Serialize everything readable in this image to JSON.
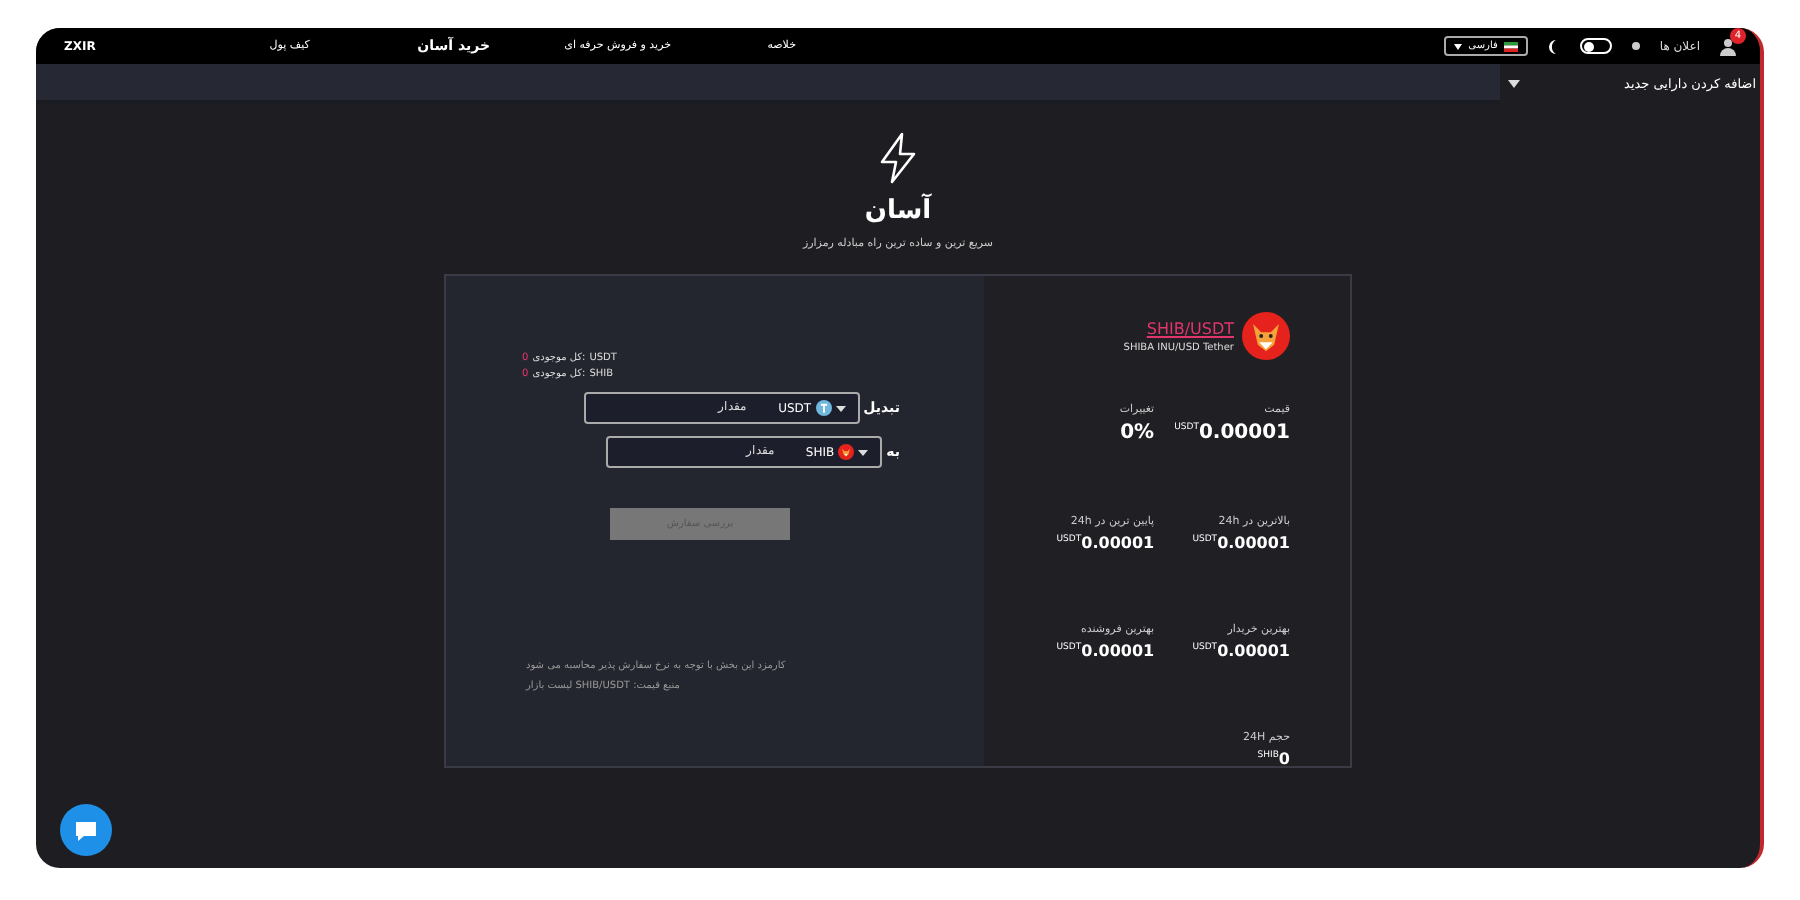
{
  "nav": {
    "logo": "ZXIR",
    "items": [
      {
        "label": "خلاصه",
        "selected": false
      },
      {
        "label": "خرید و فروش حرفه ای",
        "selected": false
      },
      {
        "label": "خرید آسان",
        "selected": true
      },
      {
        "label": "کیف پول",
        "selected": false
      }
    ],
    "language": "فارسی",
    "theme_toggle": {
      "on": false
    },
    "notifications": {
      "label": "اعلان ها",
      "badge": "4"
    }
  },
  "sub_bar": {
    "label": "اضافه کردن دارایی جدید"
  },
  "hero": {
    "title": "آسان",
    "subtitle": "سریع ترین و ساده ترین راه مبادله رمزارز"
  },
  "form": {
    "balances": [
      {
        "label": "کل موجودی:",
        "currency": "USDT",
        "value": "0"
      },
      {
        "label": "کل موجودی:",
        "currency": "SHIB",
        "value": "0"
      }
    ],
    "fields": [
      {
        "label": "تبدیل",
        "currency": "USDT",
        "kind": "tether",
        "placeholder": "مقدار"
      },
      {
        "label": "به",
        "currency": "SHIB",
        "kind": "shib",
        "placeholder": "مقدار"
      }
    ],
    "submit": {
      "label": "بررسی سفارش",
      "disabled": true
    },
    "notes": [
      "کارمزد این بخش با توجه به نرخ سفارش پذیر محاسبه می شود",
      "منبع قیمت: SHIB/USDT لیست بازار"
    ]
  },
  "market": {
    "pair": "SHIB/USDT",
    "pair_name": "SHIBA INU/USD Tether",
    "stats": [
      {
        "label": "قیمت",
        "value": "0.00001",
        "unit": "USDT"
      },
      {
        "label": "تغییرات",
        "value": "0%"
      },
      {
        "label": "بالاترین در 24h",
        "value": "0.00001",
        "unit": "USDT"
      },
      {
        "label": "پایین ترین در 24h",
        "value": "0.00001",
        "unit": "USDT"
      },
      {
        "label": "بهترین خریدار",
        "value": "0.00001",
        "unit": "USDT"
      },
      {
        "label": "بهترین فروشنده",
        "value": "0.00001",
        "unit": "USDT"
      },
      {
        "label": "حجم 24H",
        "value": "0",
        "unit": "SHIB"
      }
    ]
  }
}
